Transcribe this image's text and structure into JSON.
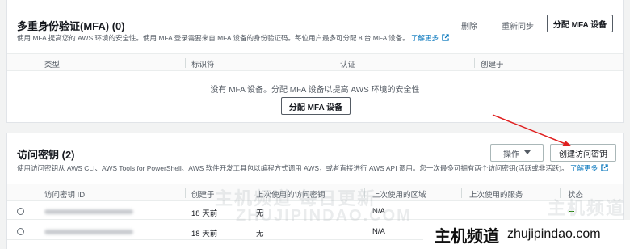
{
  "mfa": {
    "title": "多重身份验证(MFA) (0)",
    "description": "使用 MFA 提高您的 AWS 环境的安全性。使用 MFA 登录需要来自 MFA 设备的身份验证码。每位用户最多可分配 8 台 MFA 设备。",
    "learn_more": "了解更多",
    "remove_label": "删除",
    "resync_label": "重新同步",
    "assign_label": "分配 MFA 设备",
    "columns": [
      "类型",
      "标识符",
      "认证",
      "创建于"
    ],
    "empty_text": "没有 MFA 设备。分配 MFA 设备以提高 AWS 环境的安全性",
    "empty_assign_label": "分配 MFA 设备"
  },
  "access_keys": {
    "title": "访问密钥 (2)",
    "description": "使用访问密钥从 AWS CLI、AWS Tools for PowerShell、AWS 软件开发工具包以编程方式调用 AWS，或者直接进行 AWS API 调用。您一次最多可拥有两个访问密钥(活跃或非活跃)。",
    "learn_more": "了解更多",
    "actions_label": "操作",
    "create_label": "创建访问密钥",
    "columns": [
      "访问密钥 ID",
      "创建于",
      "上次使用的访问密钥",
      "上次使用的区域",
      "上次使用的服务",
      "状态"
    ],
    "rows": [
      {
        "created": "18 天前",
        "last_used": "无",
        "region": "N/A"
      },
      {
        "created": "18 天前",
        "last_used": "无",
        "region": "N/A"
      }
    ]
  },
  "watermark": {
    "cn": "主机频道 每日更新",
    "en": "ZHUJIPINDAO.COM"
  },
  "brand": {
    "cn": "主机频道",
    "url": "zhujipindao.com"
  },
  "colors": {
    "link": "#0073bb",
    "arrow": "#e02020",
    "status_active": "#1d8102"
  }
}
